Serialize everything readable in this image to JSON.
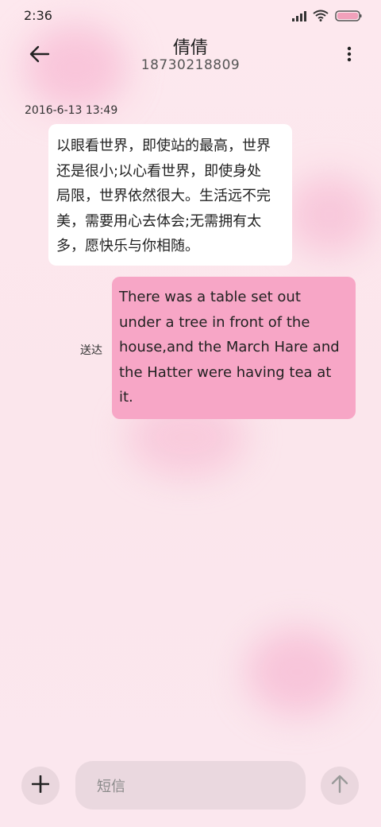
{
  "status_bar": {
    "time": "2:36",
    "icons": [
      "signal-icon",
      "wifi-icon",
      "battery-icon"
    ]
  },
  "header": {
    "contact_name": "倩倩",
    "contact_number": "18730218809",
    "back_icon": "back-arrow-icon",
    "more_icon": "more-vertical-icon"
  },
  "conversation": {
    "timestamp": "2016-6-13 13:49",
    "incoming": {
      "lines": [
        "以眼看世界，即使站的最高，世界",
        "还是很小;以心看世界，即使身处",
        "局限，世界依然很大。生活远不完",
        "美，需要用心去体会;无需拥有太",
        "多，愿快乐与你相随。"
      ]
    },
    "outgoing": {
      "lines": [
        "There was a table set out",
        "under a tree in front of the",
        "house,and the March Hare and",
        "the Hatter were having tea at",
        "it."
      ],
      "status": "送达"
    }
  },
  "compose": {
    "placeholder": "短信",
    "add_icon": "plus-icon",
    "send_icon": "send-arrow-icon"
  },
  "colors": {
    "background": "#fbe7ee",
    "incoming_bubble": "#ffffff",
    "outgoing_bubble": "#f7a6c6",
    "battery": "#f2a1bb"
  }
}
